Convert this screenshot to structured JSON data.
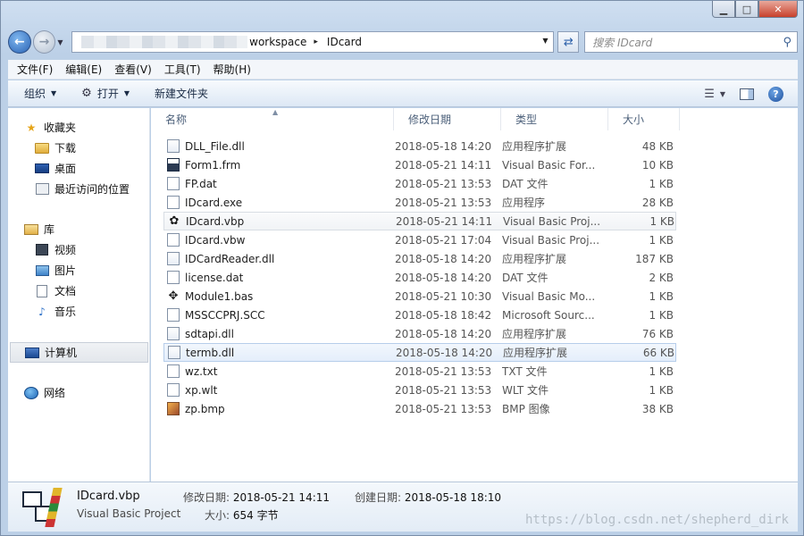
{
  "window": {
    "controls": {
      "minimize": "▁",
      "maximize": "□",
      "close": "✕"
    }
  },
  "address_bar": {
    "crumbs": [
      "workspace",
      "IDcard"
    ],
    "separator": "▸"
  },
  "search": {
    "placeholder": "搜索 IDcard"
  },
  "menu": [
    "文件(F)",
    "编辑(E)",
    "查看(V)",
    "工具(T)",
    "帮助(H)"
  ],
  "toolbar": {
    "organize": "组织",
    "open": "打开",
    "new_folder": "新建文件夹"
  },
  "nav_pane": {
    "favorites": {
      "label": "收藏夹",
      "items": [
        "下载",
        "桌面",
        "最近访问的位置"
      ]
    },
    "libraries": {
      "label": "库",
      "items": [
        "视频",
        "图片",
        "文档",
        "音乐"
      ]
    },
    "computer": "计算机",
    "network": "网络"
  },
  "columns": {
    "name": "名称",
    "date": "修改日期",
    "type": "类型",
    "size": "大小"
  },
  "files": [
    {
      "name": "DLL_File.dll",
      "date": "2018-05-18 14:20",
      "type": "应用程序扩展",
      "size": "48 KB",
      "icon": "dll"
    },
    {
      "name": "Form1.frm",
      "date": "2018-05-21 14:11",
      "type": "Visual Basic For...",
      "size": "10 KB",
      "icon": "frm"
    },
    {
      "name": "FP.dat",
      "date": "2018-05-21 13:53",
      "type": "DAT 文件",
      "size": "1 KB",
      "icon": "file"
    },
    {
      "name": "IDcard.exe",
      "date": "2018-05-21 13:53",
      "type": "应用程序",
      "size": "28 KB",
      "icon": "exe"
    },
    {
      "name": "IDcard.vbp",
      "date": "2018-05-21 14:11",
      "type": "Visual Basic Proj...",
      "size": "1 KB",
      "icon": "vbp"
    },
    {
      "name": "IDcard.vbw",
      "date": "2018-05-21 17:04",
      "type": "Visual Basic Proj...",
      "size": "1 KB",
      "icon": "file"
    },
    {
      "name": "IDCardReader.dll",
      "date": "2018-05-18 14:20",
      "type": "应用程序扩展",
      "size": "187 KB",
      "icon": "dll"
    },
    {
      "name": "license.dat",
      "date": "2018-05-18 14:20",
      "type": "DAT 文件",
      "size": "2 KB",
      "icon": "file"
    },
    {
      "name": "Module1.bas",
      "date": "2018-05-21 10:30",
      "type": "Visual Basic Mo...",
      "size": "1 KB",
      "icon": "bas"
    },
    {
      "name": "MSSCCPRJ.SCC",
      "date": "2018-05-18 18:42",
      "type": "Microsoft Sourc...",
      "size": "1 KB",
      "icon": "file"
    },
    {
      "name": "sdtapi.dll",
      "date": "2018-05-18 14:20",
      "type": "应用程序扩展",
      "size": "76 KB",
      "icon": "dll"
    },
    {
      "name": "termb.dll",
      "date": "2018-05-18 14:20",
      "type": "应用程序扩展",
      "size": "66 KB",
      "icon": "dll"
    },
    {
      "name": "wz.txt",
      "date": "2018-05-21 13:53",
      "type": "TXT 文件",
      "size": "1 KB",
      "icon": "file"
    },
    {
      "name": "xp.wlt",
      "date": "2018-05-21 13:53",
      "type": "WLT 文件",
      "size": "1 KB",
      "icon": "file"
    },
    {
      "name": "zp.bmp",
      "date": "2018-05-21 13:53",
      "type": "BMP 图像",
      "size": "38 KB",
      "icon": "bmp"
    }
  ],
  "details": {
    "name": "IDcard.vbp",
    "type": "Visual Basic Project",
    "modified_label": "修改日期:",
    "modified": "2018-05-21 14:11",
    "size_label": "大小:",
    "size": "654 字节",
    "created_label": "创建日期:",
    "created": "2018-05-18 18:10"
  },
  "watermark": "https://blog.csdn.net/shepherd_dirk"
}
